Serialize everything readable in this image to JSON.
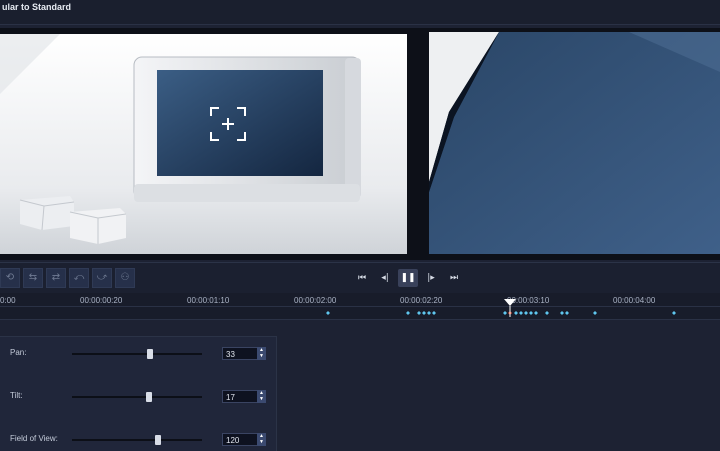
{
  "window": {
    "title": "ular to Standard"
  },
  "preview": {
    "left_icon": "crosshair-plus-icon",
    "right_label": ""
  },
  "toolbar": {
    "edit_icons": [
      "rotate-icon",
      "flip-icon",
      "split-icon",
      "merge-icon",
      "trim-icon",
      "group-icon"
    ],
    "transport": {
      "go_start": "⏮",
      "prev_frame": "◂|",
      "play_pause": "❚❚",
      "next_frame": "|▸",
      "go_end": "⏭"
    }
  },
  "timeline": {
    "ticks": [
      "0:00",
      "00:00:00:20",
      "00:00:01:10",
      "00:00:02:00",
      "00:00:02:20",
      "00:00:03:10",
      "00:00:04:00"
    ],
    "playhead_time": "00:00:03:05",
    "keyframe_color": "#5fc6ee",
    "current_keyframe_color": "#e0553a"
  },
  "properties": {
    "pan": {
      "label": "Pan:",
      "value": "33",
      "position": 0.6
    },
    "tilt": {
      "label": "Tilt:",
      "value": "17",
      "position": 0.59
    },
    "fov": {
      "label": "Field of View:",
      "value": "120",
      "position": 0.66
    }
  },
  "colors": {
    "background": "#1d2233",
    "panel": "#20263a",
    "accent": "#3b4a70"
  }
}
